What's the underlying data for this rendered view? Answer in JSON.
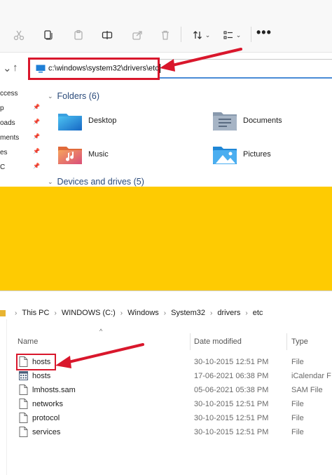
{
  "top": {
    "toolbar": {
      "buttons": [
        "cut-icon",
        "copy-icon",
        "paste-icon",
        "rename-icon",
        "share-icon",
        "delete-icon",
        "sort-icon",
        "view-icon",
        "more-icon"
      ],
      "more_label": "•••"
    },
    "address": {
      "path": "c:\\windows\\system32\\drivers\\etc"
    },
    "sidebar": {
      "items": [
        {
          "label": "ccess",
          "pinned": false
        },
        {
          "label": "p",
          "pinned": true
        },
        {
          "label": "oads",
          "pinned": true
        },
        {
          "label": "ments",
          "pinned": true
        },
        {
          "label": "es",
          "pinned": true
        },
        {
          "label": "C",
          "pinned": true
        }
      ]
    },
    "folders_header": "Folders (6)",
    "folders": [
      {
        "name": "Desktop",
        "icon": "desktop-folder-icon"
      },
      {
        "name": "Documents",
        "icon": "documents-folder-icon"
      },
      {
        "name": "Music",
        "icon": "music-folder-icon"
      },
      {
        "name": "Pictures",
        "icon": "pictures-folder-icon"
      }
    ],
    "devices_header": "Devices and drives (5)"
  },
  "bottom": {
    "breadcrumb": [
      "This PC",
      "WINDOWS (C:)",
      "Windows",
      "System32",
      "drivers",
      "etc"
    ],
    "columns": {
      "name": "Name",
      "date": "Date modified",
      "type": "Type"
    },
    "files": [
      {
        "name": "hosts",
        "date": "30-10-2015 12:51 PM",
        "type": "File",
        "icon": "file-icon"
      },
      {
        "name": "hosts",
        "date": "17-06-2021 06:38 PM",
        "type": "iCalendar F",
        "icon": "calendar-file-icon"
      },
      {
        "name": "lmhosts.sam",
        "date": "05-06-2021 05:38 PM",
        "type": "SAM File",
        "icon": "file-icon"
      },
      {
        "name": "networks",
        "date": "30-10-2015 12:51 PM",
        "type": "File",
        "icon": "file-icon"
      },
      {
        "name": "protocol",
        "date": "30-10-2015 12:51 PM",
        "type": "File",
        "icon": "file-icon"
      },
      {
        "name": "services",
        "date": "30-10-2015 12:51 PM",
        "type": "File",
        "icon": "file-icon"
      }
    ]
  },
  "colors": {
    "highlight_red": "#d9172c",
    "band_yellow": "#fecb02",
    "accent_blue": "#4a8bd6"
  }
}
